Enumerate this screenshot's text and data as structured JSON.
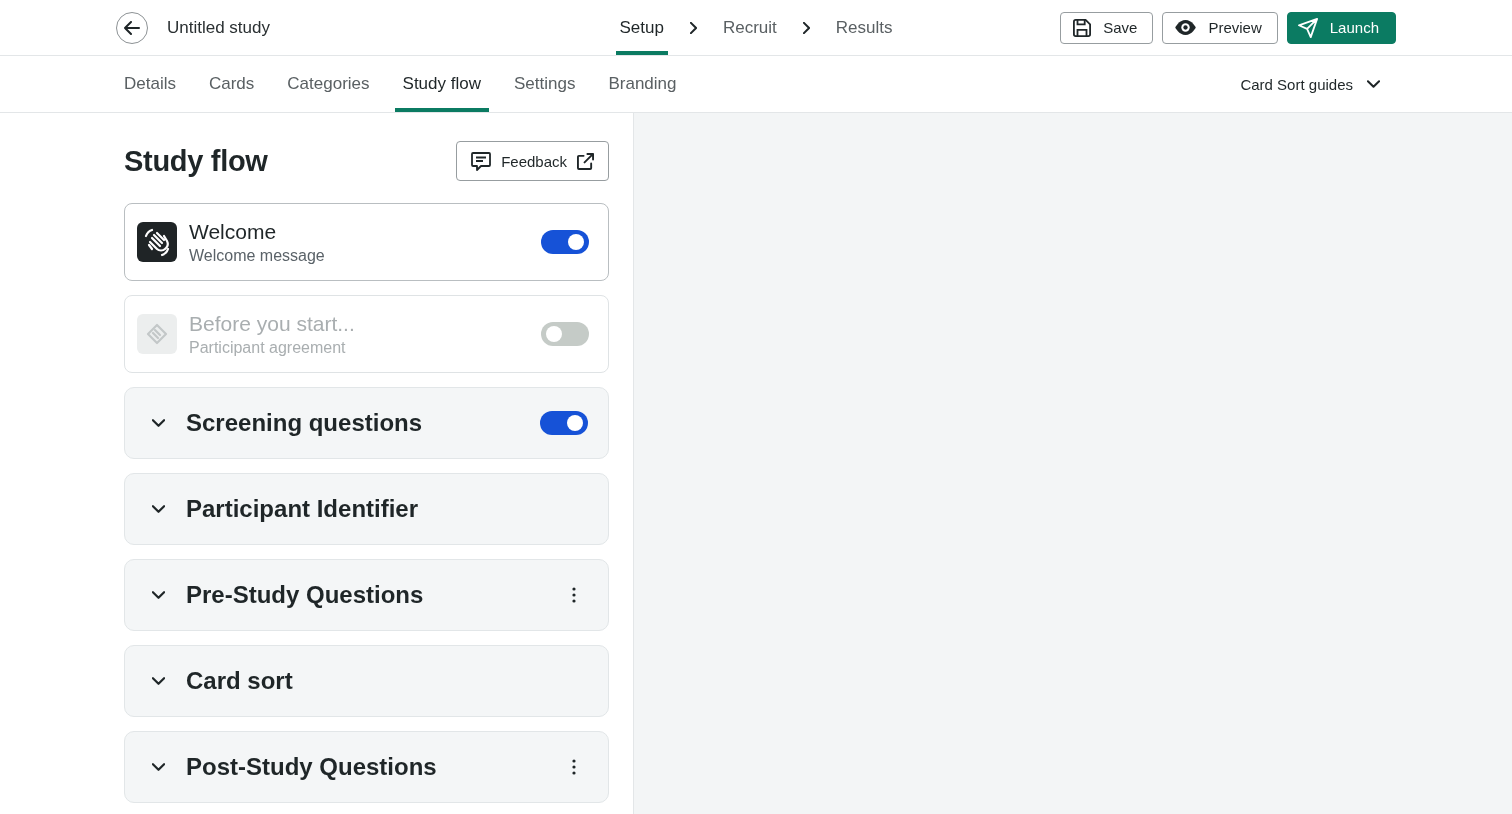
{
  "header": {
    "title": "Untitled study",
    "steps": [
      {
        "label": "Setup",
        "selected": true
      },
      {
        "label": "Recruit",
        "selected": false
      },
      {
        "label": "Results",
        "selected": false
      }
    ],
    "actions": [
      {
        "label": "Save",
        "kind": "save"
      },
      {
        "label": "Preview",
        "kind": "preview"
      },
      {
        "label": "Launch",
        "kind": "launch"
      }
    ]
  },
  "tabs": [
    {
      "label": "Details",
      "selected": false
    },
    {
      "label": "Cards",
      "selected": false
    },
    {
      "label": "Categories",
      "selected": false
    },
    {
      "label": "Study flow",
      "selected": true
    },
    {
      "label": "Settings",
      "selected": false
    },
    {
      "label": "Branding",
      "selected": false
    }
  ],
  "guides": {
    "label": "Card Sort guides"
  },
  "panel": {
    "title": "Study flow",
    "feedback": {
      "label": "Feedback"
    },
    "steps": [
      {
        "kind": "welcome",
        "title": "Welcome",
        "subtitle": "Welcome message",
        "on": true
      },
      {
        "kind": "agreement",
        "title": "Before you start...",
        "subtitle": "Participant agreement",
        "on": false
      }
    ],
    "sections": [
      {
        "title": "Screening questions",
        "kind": "toggle",
        "on": true
      },
      {
        "title": "Participant Identifier",
        "kind": "plain"
      },
      {
        "title": "Pre-Study Questions",
        "kind": "menu"
      },
      {
        "title": "Card sort",
        "kind": "plain"
      },
      {
        "title": "Post-Study Questions",
        "kind": "menu"
      }
    ]
  }
}
